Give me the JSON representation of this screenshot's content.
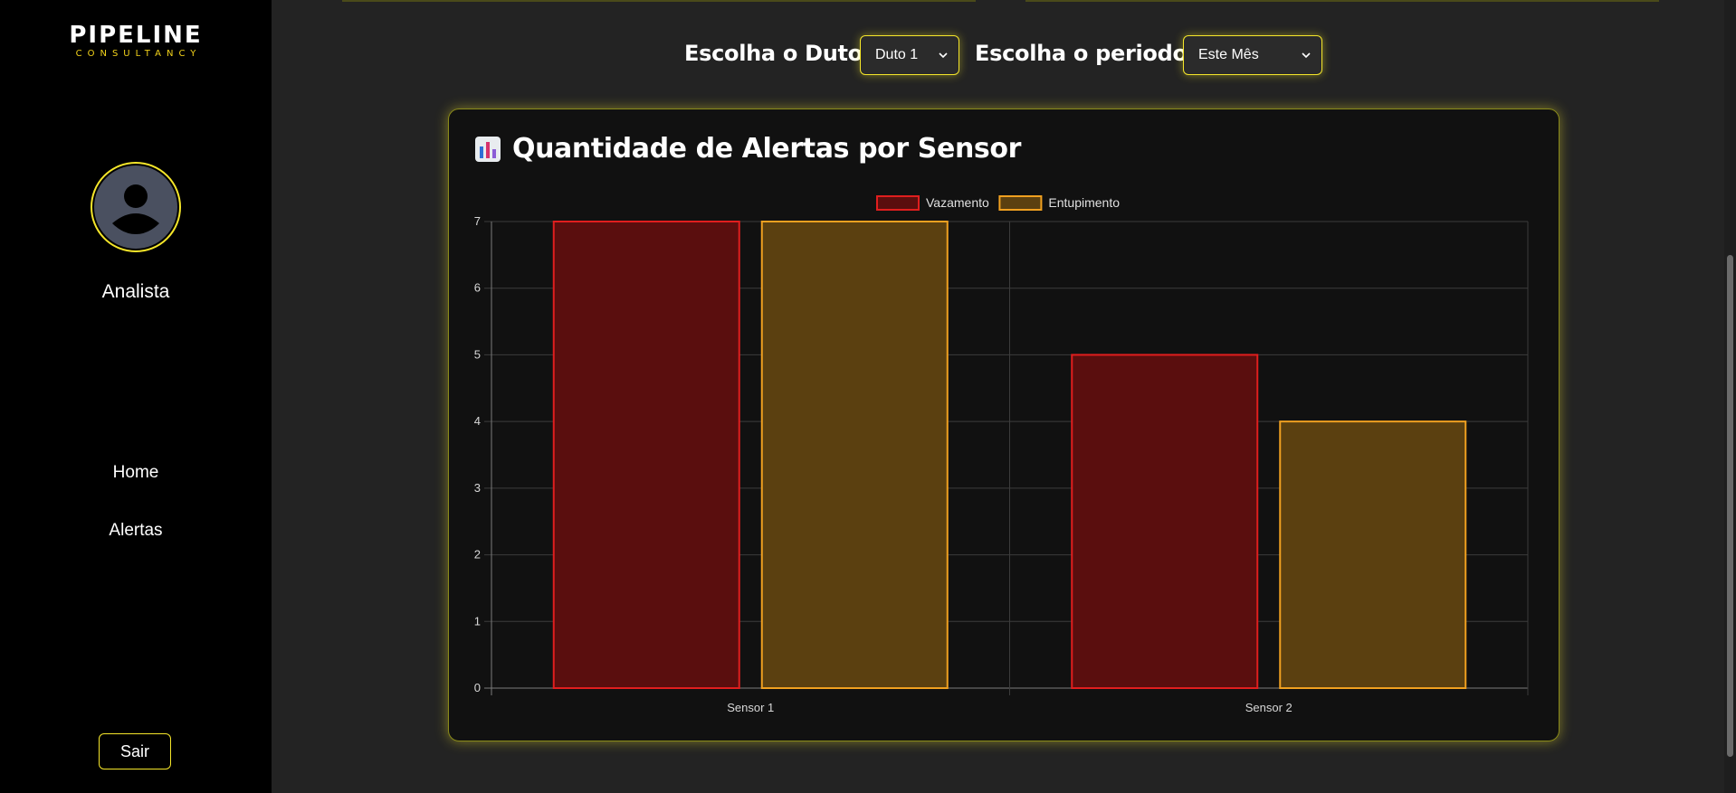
{
  "sidebar": {
    "logo_main": "PIPELINE",
    "logo_sub": "CONSULTANCY",
    "user_name": "Analista",
    "nav": [
      {
        "label": "Home"
      },
      {
        "label": "Alertas"
      }
    ],
    "logout_label": "Sair"
  },
  "filters": {
    "duct_label": "Escolha o Duto:",
    "duct_value": "Duto 1",
    "period_label": "Escolha o periodo:",
    "period_value": "Este Mês"
  },
  "card": {
    "title": "Quantidade de Alertas por Sensor",
    "title_icon": "bar-chart-icon"
  },
  "colors": {
    "accent": "#f5e62a",
    "leak_fill": "#5a0e0e",
    "leak_border": "#e01e1e",
    "clog_fill": "#5b4010",
    "clog_border": "#f0a020"
  },
  "chart_data": {
    "type": "bar",
    "categories": [
      "Sensor 1",
      "Sensor 2"
    ],
    "series": [
      {
        "name": "Vazamento",
        "values": [
          7,
          5
        ]
      },
      {
        "name": "Entupimento",
        "values": [
          7,
          4
        ]
      }
    ],
    "ylim": [
      0,
      7
    ],
    "yticks": [
      0,
      1,
      2,
      3,
      4,
      5,
      6,
      7
    ],
    "legend_position": "top",
    "grid": true
  }
}
